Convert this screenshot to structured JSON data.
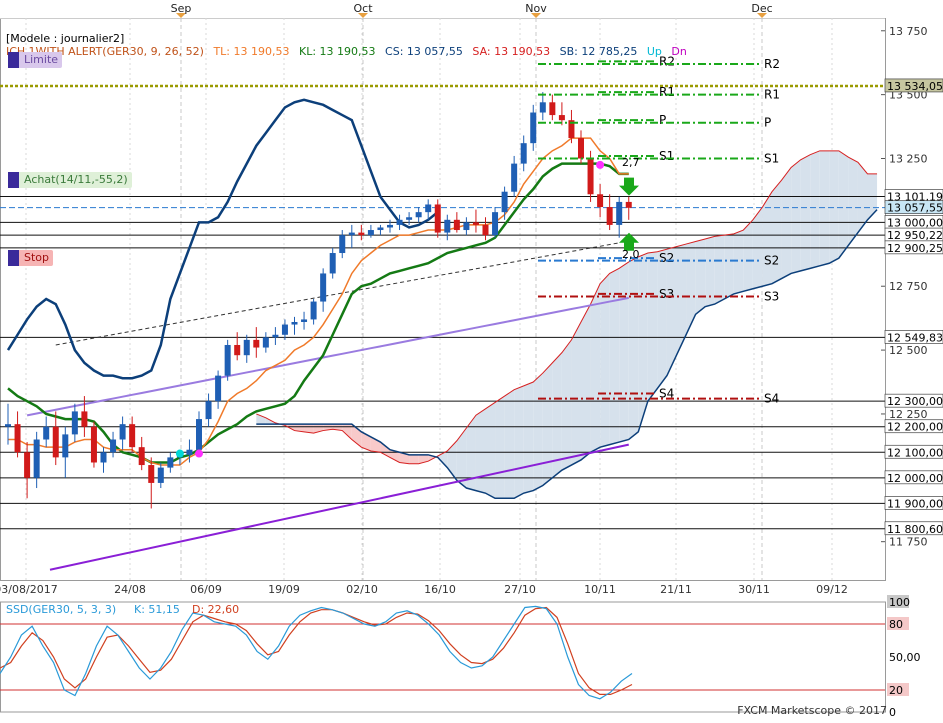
{
  "legend": {
    "model": "[Modele : journalier2]",
    "indicator": "ICH.1WITH ALERT(GER30, 9, 26, 52)",
    "tl": "TL: 13 190,53",
    "kl": "KL: 13 190,53",
    "cs": "CS: 13 057,55",
    "sa": "SA: 13 190,53",
    "sb": "SB: 12 785,25",
    "up": "Up",
    "dn": "Dn"
  },
  "badges": {
    "limite": "Limite",
    "achat": "Achat(14/11,-55,2)",
    "stop": "Stop"
  },
  "month_labels": [
    "Sep",
    "Oct",
    "Nov",
    "Dec"
  ],
  "date_labels": [
    "03/08/2017",
    "24/08",
    "06/09",
    "19/09",
    "02/10",
    "16/10",
    "27/10",
    "10/11",
    "21/11",
    "30/11",
    "09/12"
  ],
  "price_ticks": [
    "13 750",
    "13 500",
    "13 250",
    "12 750",
    "12 500",
    "12 250",
    "11 750"
  ],
  "boxed_labels": [
    {
      "text": "13 534,05",
      "color": "#c6c6a0"
    },
    {
      "text": "13 101,19",
      "color": "#ffffff"
    },
    {
      "text": "13 057,55",
      "color": "#c8e6f5"
    },
    {
      "text": "13 000,00",
      "color": "#ffffff"
    },
    {
      "text": "12 950,22",
      "color": "#ffffff"
    },
    {
      "text": "12 900,25",
      "color": "#ffffff"
    },
    {
      "text": "12 549,83",
      "color": "#ffffff"
    },
    {
      "text": "12 300,00",
      "color": "#ffffff"
    },
    {
      "text": "12 200,00",
      "color": "#ffffff"
    },
    {
      "text": "12 100,00",
      "color": "#ffffff"
    },
    {
      "text": "12 000,00",
      "color": "#ffffff"
    },
    {
      "text": "11 900,00",
      "color": "#ffffff"
    },
    {
      "text": "11 800,60",
      "color": "#ffffff"
    }
  ],
  "pivot_labels": [
    "R2",
    "R2",
    "R1",
    "R1",
    "P",
    "P",
    "S1",
    "S1",
    "S2",
    "S2",
    "S3",
    "S3",
    "S4",
    "S4"
  ],
  "annotations": {
    "upper": "2,7",
    "lower": "2,0"
  },
  "oscillator": {
    "legend": "SSD(GER30, 5, 3, 3)",
    "k": "K: 51,15",
    "d": "D: 22,60",
    "ticks": [
      "100",
      "80",
      "50,00",
      "20",
      "0"
    ]
  },
  "watermark": "FXCM Marketscope © 2017",
  "colors": {
    "bull": "#1f5fb4",
    "bear": "#d11a1a",
    "tenkan": "#f07a2a",
    "kijun": "#147a14",
    "chikou": "#0c3f7a",
    "ssa": "#d62020",
    "ssb": "#0c3f7a",
    "cloud_bull": "#d6e1ec",
    "cloud_bear": "#f8caca",
    "ma": "#9a7be0",
    "trend": "#8a1fd6"
  },
  "chart_data": {
    "type": "candlestick",
    "x_axis_labels": [
      "03/08/2017",
      "24/08",
      "06/09",
      "19/09",
      "02/10",
      "16/10",
      "27/10",
      "10/11",
      "21/11",
      "30/11",
      "09/12"
    ],
    "y_axis_labels": [
      "13 750",
      "13 500",
      "13 250",
      "12 750",
      "12 500",
      "12 250",
      "11 750"
    ],
    "ylim": [
      11600,
      13800
    ],
    "candles": [
      [
        12200,
        12290,
        12130,
        12210
      ],
      [
        12210,
        12260,
        12080,
        12100
      ],
      [
        12100,
        12140,
        11920,
        12000
      ],
      [
        12000,
        12180,
        11960,
        12150
      ],
      [
        12150,
        12240,
        12120,
        12200
      ],
      [
        12200,
        12260,
        12050,
        12080
      ],
      [
        12080,
        12200,
        12000,
        12170
      ],
      [
        12170,
        12290,
        12140,
        12260
      ],
      [
        12260,
        12320,
        12160,
        12200
      ],
      [
        12200,
        12220,
        12040,
        12060
      ],
      [
        12060,
        12120,
        12020,
        12100
      ],
      [
        12100,
        12180,
        12080,
        12150
      ],
      [
        12150,
        12240,
        12110,
        12210
      ],
      [
        12210,
        12240,
        12100,
        12120
      ],
      [
        12120,
        12160,
        12030,
        12050
      ],
      [
        12050,
        12080,
        11880,
        11980
      ],
      [
        11980,
        12060,
        11960,
        12040
      ],
      [
        12040,
        12100,
        12020,
        12080
      ],
      [
        12080,
        12110,
        12050,
        12090
      ],
      [
        12090,
        12150,
        12060,
        12110
      ],
      [
        12110,
        12260,
        12090,
        12230
      ],
      [
        12230,
        12330,
        12200,
        12300
      ],
      [
        12300,
        12420,
        12270,
        12400
      ],
      [
        12400,
        12540,
        12380,
        12520
      ],
      [
        12520,
        12570,
        12460,
        12480
      ],
      [
        12480,
        12560,
        12450,
        12540
      ],
      [
        12540,
        12590,
        12470,
        12510
      ],
      [
        12510,
        12570,
        12490,
        12550
      ],
      [
        12550,
        12590,
        12520,
        12560
      ],
      [
        12560,
        12620,
        12540,
        12600
      ],
      [
        12600,
        12630,
        12560,
        12610
      ],
      [
        12610,
        12650,
        12580,
        12620
      ],
      [
        12620,
        12700,
        12600,
        12690
      ],
      [
        12690,
        12820,
        12650,
        12800
      ],
      [
        12800,
        12900,
        12780,
        12880
      ],
      [
        12880,
        12970,
        12860,
        12950
      ],
      [
        12950,
        12990,
        12900,
        12960
      ],
      [
        12960,
        12990,
        12930,
        12950
      ],
      [
        12950,
        12990,
        12940,
        12970
      ],
      [
        12970,
        12990,
        12950,
        12980
      ],
      [
        12980,
        13010,
        12960,
        12990
      ],
      [
        12990,
        13030,
        12970,
        13010
      ],
      [
        13010,
        13040,
        12990,
        13020
      ],
      [
        13020,
        13060,
        13000,
        13040
      ],
      [
        13040,
        13090,
        13010,
        13070
      ],
      [
        13070,
        13090,
        12940,
        12960
      ],
      [
        12960,
        13030,
        12930,
        13010
      ],
      [
        13010,
        13040,
        12960,
        12970
      ],
      [
        12970,
        13020,
        12950,
        13000
      ],
      [
        13000,
        13050,
        12960,
        12990
      ],
      [
        12990,
        13020,
        12930,
        12950
      ],
      [
        12950,
        13060,
        12940,
        13040
      ],
      [
        13040,
        13140,
        13010,
        13120
      ],
      [
        13120,
        13260,
        13100,
        13230
      ],
      [
        13230,
        13340,
        13200,
        13310
      ],
      [
        13310,
        13460,
        13280,
        13430
      ],
      [
        13430,
        13510,
        13400,
        13470
      ],
      [
        13470,
        13500,
        13400,
        13420
      ],
      [
        13420,
        13470,
        13380,
        13400
      ],
      [
        13400,
        13440,
        13310,
        13330
      ],
      [
        13330,
        13360,
        13230,
        13250
      ],
      [
        13250,
        13280,
        13080,
        13110
      ],
      [
        13110,
        13150,
        13020,
        13060
      ],
      [
        13060,
        13110,
        12970,
        12990
      ],
      [
        12990,
        13100,
        12940,
        13080
      ],
      [
        13080,
        13100,
        13010,
        13057
      ]
    ],
    "series": [
      {
        "name": "TL",
        "values": [
          12150,
          12150,
          12130,
          12130,
          12120,
          12120,
          12120,
          12140,
          12150,
          12150,
          12120,
          12110,
          12110,
          12110,
          12080,
          12060,
          12050,
          12050,
          12050,
          12080,
          12100,
          12150,
          12220,
          12300,
          12330,
          12350,
          12380,
          12420,
          12440,
          12460,
          12500,
          12520,
          12550,
          12600,
          12660,
          12720,
          12800,
          12850,
          12880,
          12910,
          12930,
          12950,
          12950,
          12960,
          12970,
          12970,
          12970,
          12980,
          12990,
          12990,
          12990,
          13000,
          13030,
          13080,
          13150,
          13200,
          13250,
          13280,
          13300,
          13330,
          13330,
          13330,
          13280,
          13250,
          13190,
          13190
        ]
      },
      {
        "name": "KL",
        "values": [
          12350,
          12320,
          12300,
          12280,
          12250,
          12240,
          12230,
          12230,
          12230,
          12220,
          12180,
          12130,
          12100,
          12090,
          12080,
          12060,
          12060,
          12060,
          12080,
          12090,
          12110,
          12140,
          12170,
          12190,
          12210,
          12240,
          12260,
          12270,
          12280,
          12290,
          12320,
          12380,
          12430,
          12480,
          12560,
          12640,
          12720,
          12750,
          12760,
          12780,
          12800,
          12810,
          12820,
          12830,
          12840,
          12860,
          12880,
          12890,
          12900,
          12910,
          12920,
          12940,
          12990,
          13040,
          13090,
          13130,
          13180,
          13210,
          13230,
          13230,
          13230,
          13230,
          13230,
          13220,
          13190,
          13190
        ]
      },
      {
        "name": "CS",
        "values": [
          12500,
          12560,
          12620,
          12670,
          12700,
          12680,
          12600,
          12500,
          12450,
          12420,
          12400,
          12400,
          12390,
          12390,
          12400,
          12420,
          12520,
          12700,
          12800,
          12900,
          13000,
          13000,
          13020,
          13080,
          13160,
          13230,
          13300,
          13350,
          13400,
          13450,
          13470,
          13480,
          13470,
          13460,
          13440,
          13420,
          13400,
          13300,
          13200,
          13100,
          13050,
          13000,
          12980,
          12990,
          13010,
          13040
        ]
      }
    ],
    "pivot_levels": [
      13630,
      13620,
      13510,
      13500,
      13400,
      13390,
      13260,
      13250,
      13000,
      12990,
      12860,
      12850,
      12720,
      12710,
      12330,
      12310,
      12000,
      11990
    ],
    "horizontal_levels": [
      13534.05,
      13101.19,
      13057.55,
      13000.0,
      12950.22,
      12900.25,
      12549.83,
      12300.0,
      12200.0,
      12100.0,
      12000.0,
      11900.0,
      11800.6
    ],
    "oscillator": {
      "k_last": 51.15,
      "d_last": 22.6,
      "ylim": [
        0,
        100
      ],
      "levels": [
        80,
        20
      ],
      "k": [
        35,
        50,
        70,
        78,
        60,
        45,
        20,
        15,
        35,
        60,
        78,
        70,
        55,
        40,
        30,
        40,
        55,
        75,
        90,
        88,
        82,
        80,
        78,
        70,
        55,
        48,
        60,
        78,
        88,
        92,
        95,
        93,
        90,
        85,
        80,
        78,
        82,
        90,
        92,
        88,
        80,
        70,
        55,
        45,
        40,
        42,
        50,
        65,
        80,
        95,
        96,
        94,
        80,
        50,
        25,
        15,
        12,
        18,
        28,
        35
      ],
      "d": [
        40,
        45,
        60,
        72,
        65,
        50,
        30,
        22,
        30,
        50,
        68,
        70,
        60,
        48,
        36,
        38,
        48,
        65,
        82,
        88,
        85,
        82,
        80,
        74,
        62,
        52,
        55,
        70,
        82,
        90,
        93,
        93,
        90,
        86,
        82,
        79,
        80,
        86,
        90,
        89,
        83,
        74,
        62,
        52,
        45,
        44,
        48,
        58,
        72,
        88,
        94,
        95,
        86,
        62,
        35,
        22,
        16,
        16,
        20,
        25
      ]
    }
  }
}
